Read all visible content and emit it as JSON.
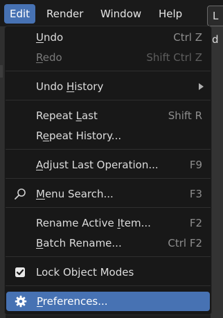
{
  "menubar": {
    "items": [
      {
        "label": "Edit"
      },
      {
        "label": "Render"
      },
      {
        "label": "Window"
      },
      {
        "label": "Help"
      }
    ],
    "right_tab": "L"
  },
  "background": {
    "right_text": "d"
  },
  "edit_menu": {
    "undo": {
      "pre": "",
      "ul": "U",
      "post": "ndo",
      "shortcut": "Ctrl Z"
    },
    "redo": {
      "pre": "",
      "ul": "R",
      "post": "edo",
      "shortcut": "Shift Ctrl Z"
    },
    "undo_history": {
      "pre": "Undo ",
      "ul": "H",
      "post": "istory"
    },
    "repeat_last": {
      "pre": "Repeat ",
      "ul": "L",
      "post": "ast",
      "shortcut": "Shift R"
    },
    "repeat_history": {
      "pre": "R",
      "ul": "e",
      "post": "peat History..."
    },
    "adjust_last": {
      "pre": "",
      "ul": "A",
      "post": "djust Last Operation...",
      "shortcut": "F9"
    },
    "menu_search": {
      "pre": "",
      "ul": "M",
      "post": "enu Search...",
      "shortcut": "F3"
    },
    "rename_active": {
      "pre": "Rename Active ",
      "ul": "I",
      "post": "tem...",
      "shortcut": "F2"
    },
    "batch_rename": {
      "pre": "",
      "ul": "B",
      "post": "atch Rename...",
      "shortcut": "Ctrl F2"
    },
    "lock_object_modes": {
      "label": "Lock Object Modes",
      "checked": true
    },
    "preferences": {
      "pre": "",
      "ul": "P",
      "post": "references..."
    }
  },
  "colors": {
    "accent": "#4772b3",
    "menu_bg": "#181818",
    "text": "#dcdcdc",
    "shortcut": "#8e8e8e"
  }
}
